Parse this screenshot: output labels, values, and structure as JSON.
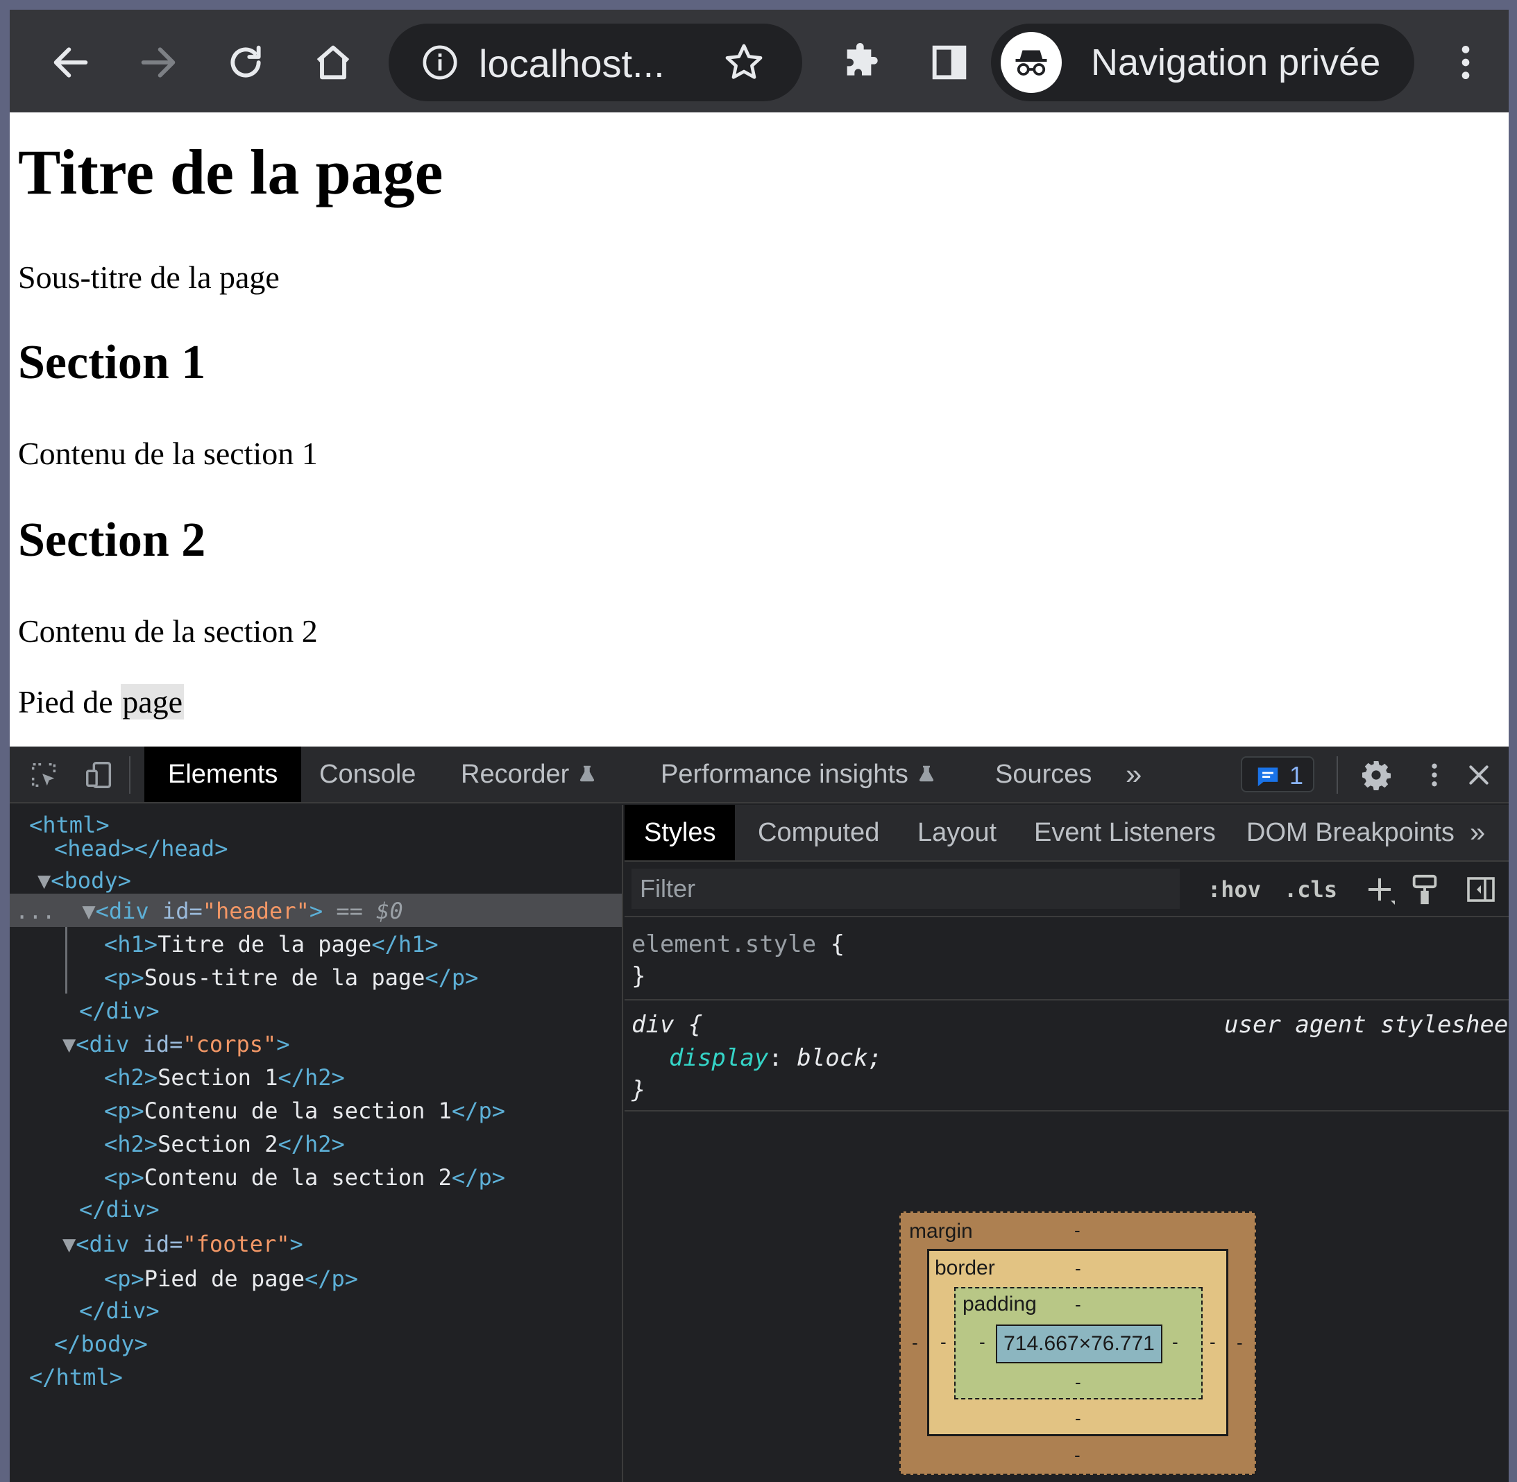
{
  "browser": {
    "url": "localhost...",
    "incognito_label": "Navigation privée"
  },
  "page": {
    "h1": "Titre de la page",
    "subtitle": "Sous-titre de la page",
    "section1_title": "Section 1",
    "section1_text": "Contenu de la section 1",
    "section2_title": "Section 2",
    "section2_text": "Contenu de la section 2",
    "footer_prefix": "Pied de ",
    "footer_highlight": "page"
  },
  "devtools": {
    "tabs": [
      "Elements",
      "Console",
      "Recorder",
      "Performance insights",
      "Sources"
    ],
    "more": "»",
    "issues_count": "1",
    "dom": {
      "html_open": "<html>",
      "head": "<head></head>",
      "body_open": "<body>",
      "header_open_tag": "<div",
      "header_attr_name": "id=",
      "header_attr_value": "\"header\"",
      "header_close_bracket": ">",
      "selected_marker": "== $0",
      "h1_open": "<h1>",
      "h1_text": "Titre de la page",
      "h1_close": "</h1>",
      "p_open": "<p>",
      "p_sub_text": "Sous-titre de la page",
      "p_close": "</p>",
      "div_close": "</div>",
      "corps_attr_value": "\"corps\"",
      "h2_open": "<h2>",
      "h2_close": "</h2>",
      "h2_1_text": "Section 1",
      "p_1_text": "Contenu de la section 1",
      "h2_2_text": "Section 2",
      "p_2_text": "Contenu de la section 2",
      "footer_attr_value": "\"footer\"",
      "p_footer_text": "Pied de page",
      "body_close": "</body>",
      "html_close": "</html>",
      "ellipsis": "..."
    },
    "styles": {
      "tabs": [
        "Styles",
        "Computed",
        "Layout",
        "Event Listeners",
        "DOM Breakpoints"
      ],
      "more": "»",
      "filter_placeholder": "Filter",
      "hov": ":hov",
      "cls": ".cls",
      "element_style_selector": "element.style",
      "brace_open": "{",
      "brace_close": "}",
      "div_selector": "div",
      "ua_label": "user agent stylesheet",
      "prop_name": "display",
      "prop_value": "block;",
      "colon": ":"
    },
    "box_model": {
      "margin_label": "margin",
      "border_label": "border",
      "padding_label": "padding",
      "content_size": "714.667×76.771",
      "dash": "-"
    }
  },
  "colors": {
    "toolbar": "#35363a",
    "devtools_bg": "#202124",
    "tag_blue": "#5db0d7",
    "attr_orange": "#f29766",
    "prop_teal": "#35d4c7",
    "margin": "#ad8051",
    "border": "#e2c383",
    "padding": "#b8c786",
    "content": "#8cb6c0"
  },
  "icons": [
    "back-arrow-icon",
    "forward-arrow-icon",
    "reload-icon",
    "home-icon",
    "info-icon",
    "star-icon",
    "extensions-icon",
    "side-panel-icon",
    "incognito-icon",
    "kebab-menu-icon",
    "inspect-icon",
    "device-toolbar-icon",
    "flask-icon",
    "chat-icon",
    "gear-icon",
    "close-icon",
    "paint-icon",
    "sidebar-toggle-icon"
  ]
}
